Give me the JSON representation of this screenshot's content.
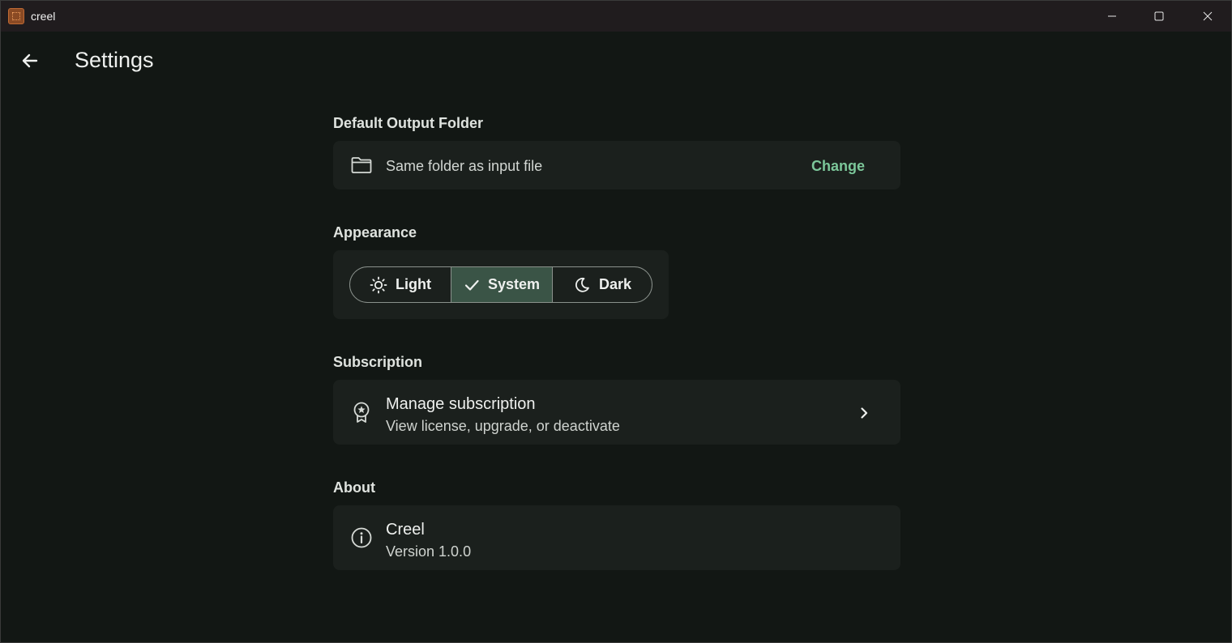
{
  "window": {
    "title": "creel",
    "controls": {
      "minimize": "minimize",
      "maximize": "maximize",
      "close": "close"
    }
  },
  "header": {
    "title": "Settings"
  },
  "sections": {
    "output_folder": {
      "label": "Default Output Folder",
      "value": "Same folder as input file",
      "action": "Change",
      "icon": "folder-icon"
    },
    "appearance": {
      "label": "Appearance",
      "options": [
        {
          "label": "Light",
          "icon": "sun-icon",
          "selected": false
        },
        {
          "label": "System",
          "icon": "check-icon",
          "selected": true
        },
        {
          "label": "Dark",
          "icon": "moon-icon",
          "selected": false
        }
      ]
    },
    "subscription": {
      "label": "Subscription",
      "title": "Manage subscription",
      "subtitle": "View license, upgrade, or deactivate",
      "icon": "award-icon"
    },
    "about": {
      "label": "About",
      "title": "Creel",
      "subtitle": "Version 1.0.0",
      "icon": "info-icon"
    }
  },
  "colors": {
    "background": "#121714",
    "card": "#1b201d",
    "accent": "#7cc79a",
    "selected_segment": "#3a5446",
    "titlebar": "#201c1e"
  }
}
